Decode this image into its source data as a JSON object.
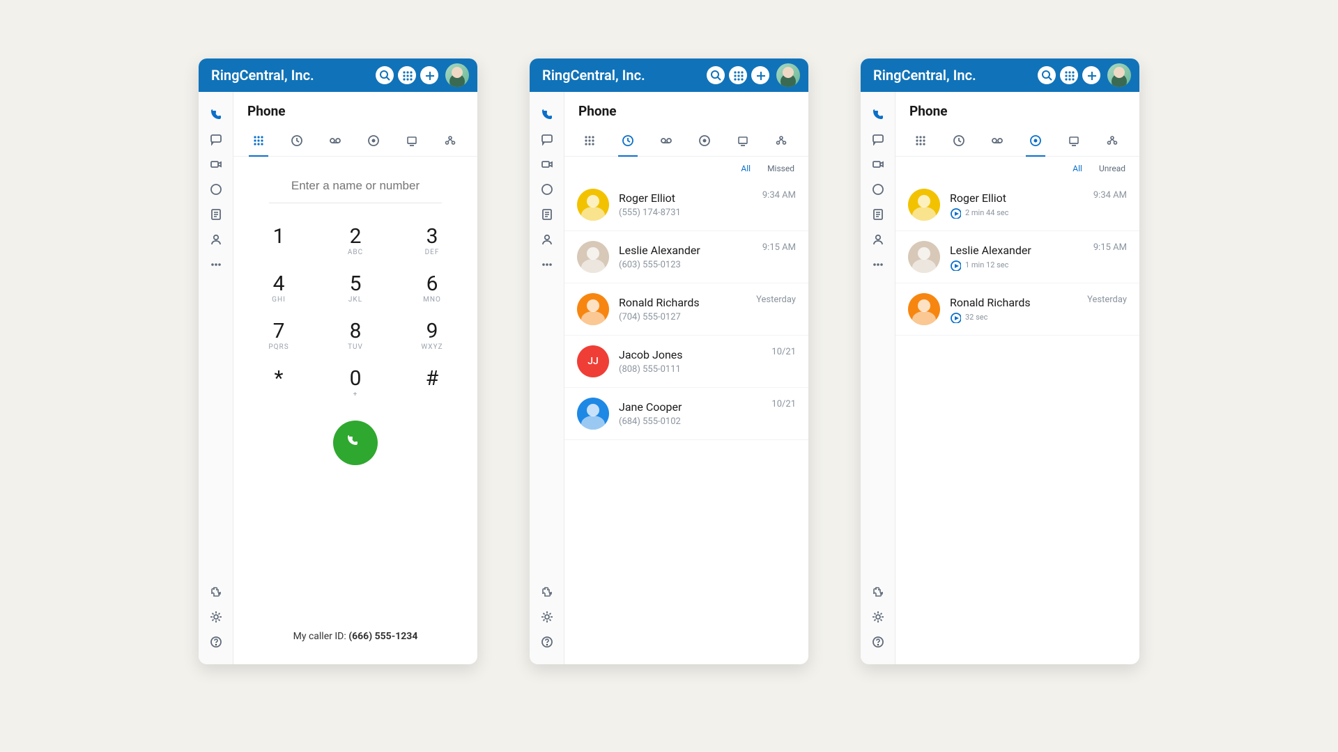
{
  "app_title": "RingCentral, Inc.",
  "section_title": "Phone",
  "filter_all": "All",
  "filter_missed": "Missed",
  "filter_unread": "Unread",
  "dialer": {
    "placeholder": "Enter a name or number",
    "caller_id_label": "My caller ID: ",
    "caller_id_value": "(666) 555-1234",
    "keys": [
      {
        "d": "1",
        "l": ""
      },
      {
        "d": "2",
        "l": "ABC"
      },
      {
        "d": "3",
        "l": "DEF"
      },
      {
        "d": "4",
        "l": "GHI"
      },
      {
        "d": "5",
        "l": "JKL"
      },
      {
        "d": "6",
        "l": "MNO"
      },
      {
        "d": "7",
        "l": "PQRS"
      },
      {
        "d": "8",
        "l": "TUV"
      },
      {
        "d": "9",
        "l": "WXYZ"
      },
      {
        "d": "*",
        "l": ""
      },
      {
        "d": "0",
        "l": "+"
      },
      {
        "d": "#",
        "l": ""
      }
    ]
  },
  "calls": [
    {
      "name": "Roger Elliot",
      "sub": "(555) 174-8731",
      "time": "9:34 AM",
      "color": "#f2c200",
      "initials": "",
      "photo": true
    },
    {
      "name": "Leslie Alexander",
      "sub": "(603) 555-0123",
      "time": "9:15 AM",
      "color": "#d8c8b8",
      "initials": "",
      "photo": true
    },
    {
      "name": "Ronald Richards",
      "sub": "(704) 555-0127",
      "time": "Yesterday",
      "color": "#f78611",
      "initials": "",
      "photo": true
    },
    {
      "name": "Jacob Jones",
      "sub": "(808) 555-0111",
      "time": "10/21",
      "color": "#ef3e36",
      "initials": "JJ",
      "photo": false
    },
    {
      "name": "Jane Cooper",
      "sub": "(684) 555-0102",
      "time": "10/21",
      "color": "#1e88e5",
      "initials": "",
      "photo": true
    }
  ],
  "recordings": [
    {
      "name": "Roger Elliot",
      "duration": "2 min 44 sec",
      "time": "9:34 AM",
      "color": "#f2c200",
      "photo": true
    },
    {
      "name": "Leslie Alexander",
      "duration": "1 min 12 sec",
      "time": "9:15 AM",
      "color": "#d8c8b8",
      "photo": true
    },
    {
      "name": "Ronald Richards",
      "duration": "32 sec",
      "time": "Yesterday",
      "color": "#f78611",
      "photo": true
    }
  ]
}
